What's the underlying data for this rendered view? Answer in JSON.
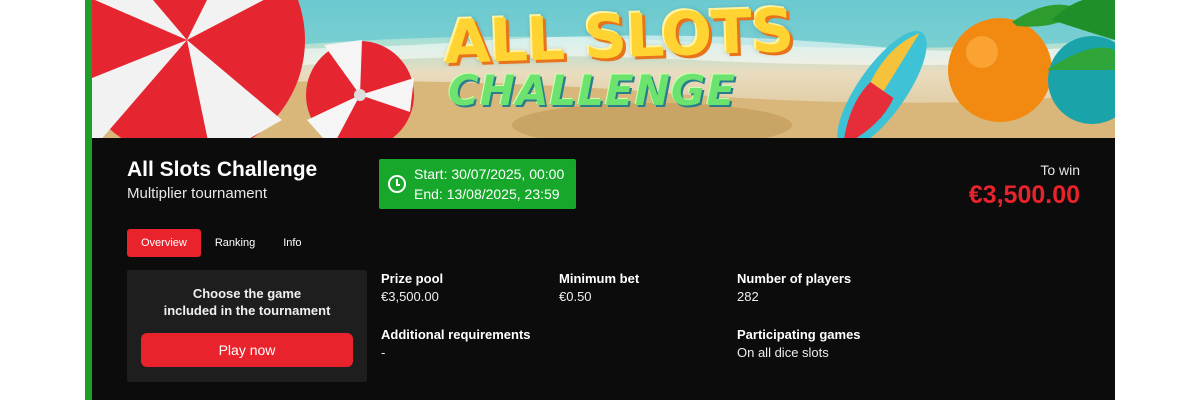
{
  "banner": {
    "title_line1": "ALL SLOTS",
    "title_line2": "CHALLENGE"
  },
  "tournament": {
    "title": "All Slots Challenge",
    "subtitle": "Multiplier tournament",
    "start": "Start: 30/07/2025, 00:00",
    "end": "End: 13/08/2025, 23:59",
    "prize_label": "To win",
    "prize_amount": "€3,500.00"
  },
  "tabs": [
    {
      "label": "Overview",
      "active": true
    },
    {
      "label": "Ranking",
      "active": false
    },
    {
      "label": "Info",
      "active": false
    }
  ],
  "choose_box": {
    "line1": "Choose the game",
    "line2": "included in the tournament",
    "button_label": "Play now"
  },
  "details": {
    "prize_pool": {
      "label": "Prize pool",
      "value": "€3,500.00"
    },
    "minimum_bet": {
      "label": "Minimum bet",
      "value": "€0.50"
    },
    "number_of_players": {
      "label": "Number of players",
      "value": "282"
    },
    "additional_requirements": {
      "label": "Additional requirements",
      "value": "-"
    },
    "participating_games": {
      "label": "Participating games",
      "value": "On all dice slots"
    }
  },
  "colors": {
    "accent_red": "#e8232b",
    "date_green": "#17a82b",
    "side_green": "#1f9e2c",
    "card_bg": "#0c0c0c"
  },
  "icons": {
    "dates": "clock-icon"
  }
}
